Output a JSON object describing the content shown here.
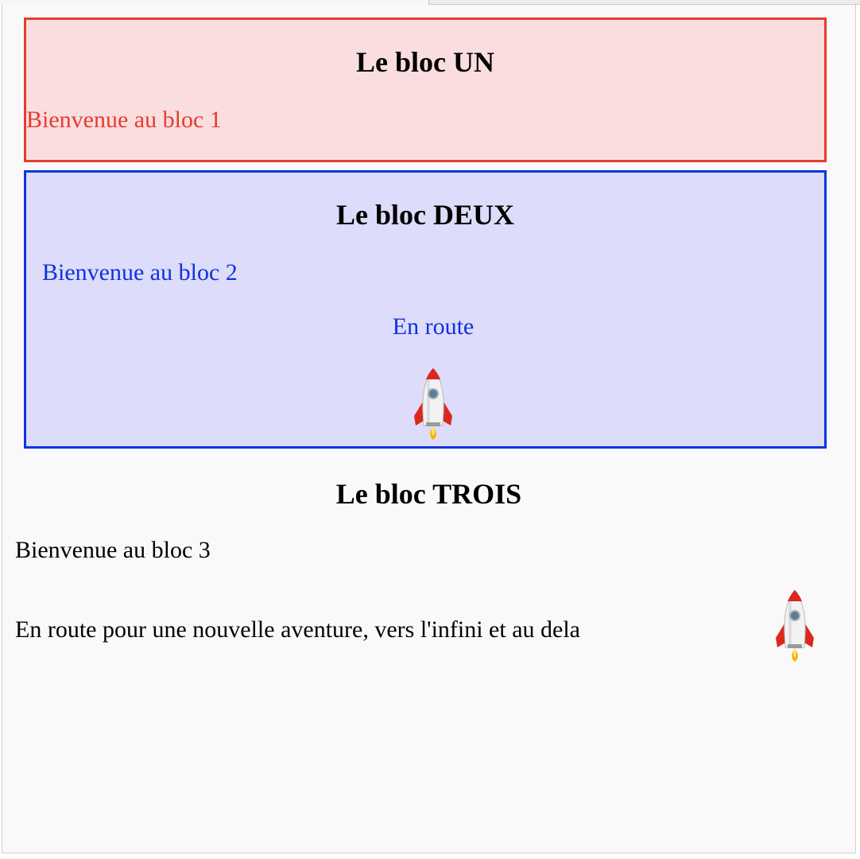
{
  "blocks": {
    "one": {
      "title": "Le bloc UN",
      "welcome": "Bienvenue au bloc 1",
      "border_color": "#e63c2e",
      "background": "#fadedf"
    },
    "two": {
      "title": "Le bloc DEUX",
      "welcome": "Bienvenue au bloc 2",
      "caption": "En route",
      "icon": "rocket-icon",
      "border_color": "#0f32e0",
      "background": "#dddcfa"
    },
    "three": {
      "title": "Le bloc TROIS",
      "welcome": "Bienvenue au bloc 3",
      "adventure": "En route pour une nouvelle aventure, vers l'infini et au dela",
      "icon": "rocket-icon"
    }
  }
}
